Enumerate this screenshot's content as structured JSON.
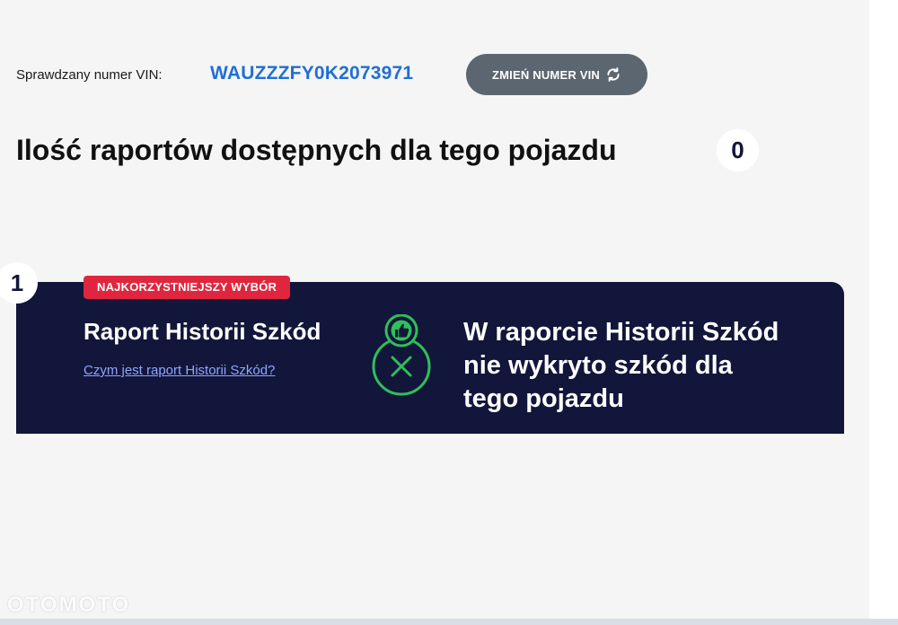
{
  "vin": {
    "label": "Sprawdzany numer VIN:",
    "value": "WAUZZZFY0K2073971",
    "change_button_label": "ZMIEŃ NUMER VIN"
  },
  "reports": {
    "heading": "Ilość raportów dostępnych dla tego pojazdu",
    "count": "0"
  },
  "report_card": {
    "rank": "1",
    "badge": "NAJKORZYSTNIEJSZY WYBÓR",
    "title": "Raport Historii Szkód",
    "info_link": "Czym jest raport Historii Szkód?",
    "status_text": "W raporcie Historii Szkód nie wykryto szkód dla tego pojazdu",
    "status_color": "#2fbf5b"
  },
  "watermark": "OTOMOTO",
  "icons": {
    "refresh": "refresh-icon",
    "thumbs_up": "thumbs-up-icon",
    "no_damage": "x-circle-icon"
  },
  "colors": {
    "vin_blue": "#1f6fd6",
    "card_bg": "#12163a",
    "badge_red": "#e0263e",
    "button_gray": "#5c6670",
    "link": "#8fa6ff",
    "status_green": "#2fbf5b"
  }
}
